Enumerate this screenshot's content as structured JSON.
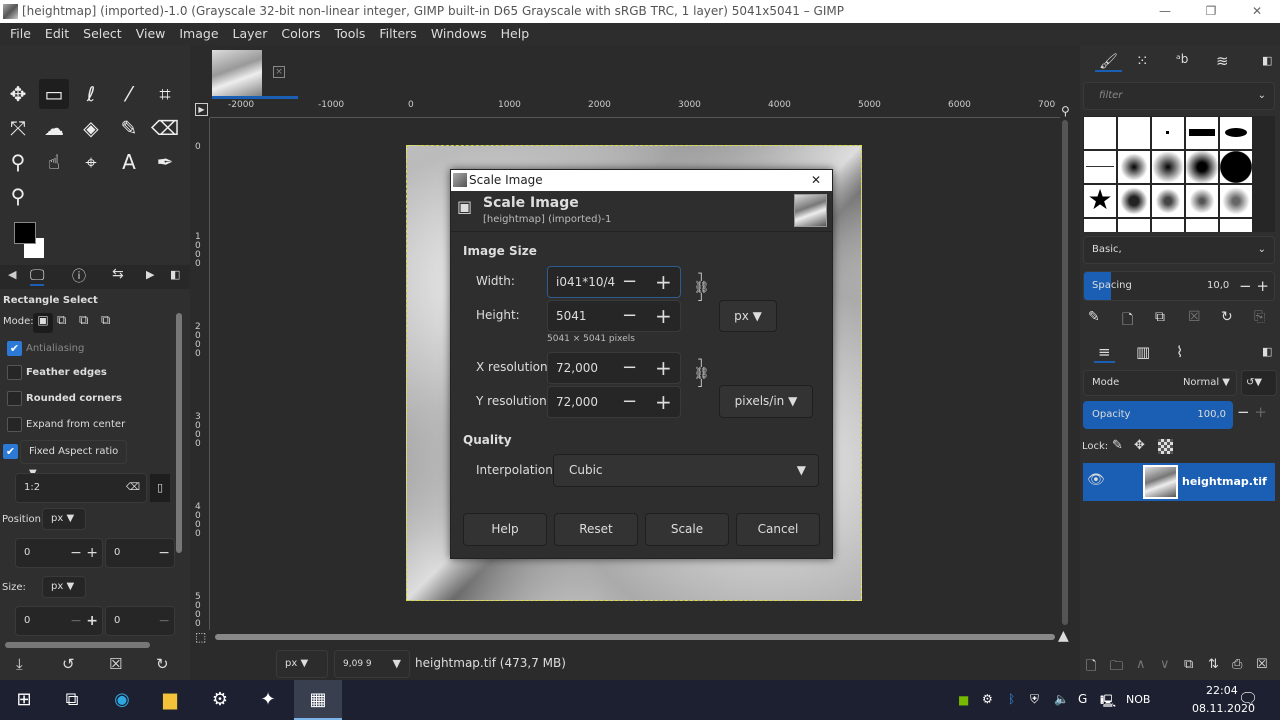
{
  "window": {
    "title": "[heightmap] (imported)-1.0 (Grayscale 32-bit non-linear integer, GIMP built-in D65 Grayscale with sRGB TRC, 1 layer) 5041x5041 – GIMP",
    "minimize": "—",
    "maximize": "❐",
    "close": "✕"
  },
  "menu": [
    "File",
    "Edit",
    "Select",
    "View",
    "Image",
    "Layer",
    "Colors",
    "Tools",
    "Filters",
    "Windows",
    "Help"
  ],
  "tool_options": {
    "title": "Rectangle Select",
    "mode_label": "Mode:",
    "antialiasing": "Antialiasing",
    "feather": "Feather edges",
    "rounded": "Rounded corners",
    "expand": "Expand from center",
    "fixed": "Fixed  Aspect ratio",
    "ratio": "1:2",
    "position_label": "Position:",
    "position_unit": "px",
    "pos_x": "0",
    "pos_y": "0",
    "size_label": "Size:",
    "size_unit": "px",
    "size_x": "0",
    "size_y": "0"
  },
  "rulers": {
    "h": [
      "-2000",
      "-1000",
      "0",
      "1000",
      "2000",
      "3000",
      "4000",
      "5000",
      "6000",
      "700"
    ],
    "v": [
      "0",
      "1000",
      "2000",
      "3000",
      "4000",
      "5000"
    ]
  },
  "dialog": {
    "window_title": "Scale Image",
    "heading": "Scale Image",
    "subtitle": "[heightmap] (imported)-1",
    "image_size": "Image Size",
    "width_label": "Width:",
    "width_value": "i041*10/4",
    "height_label": "Height:",
    "height_value": "5041",
    "size_info": "5041 × 5041 pixels",
    "unit": "px",
    "xres_label": "X resolution:",
    "xres_value": "72,000",
    "yres_label": "Y resolution:",
    "yres_value": "72,000",
    "res_unit": "pixels/in",
    "quality": "Quality",
    "interp_label": "Interpolation:",
    "interp_value": "Cubic",
    "help": "Help",
    "reset": "Reset",
    "scale": "Scale",
    "cancel": "Cancel",
    "close": "✕"
  },
  "brushes": {
    "filter_placeholder": "filter",
    "tag": "Basic,",
    "spacing_label": "Spacing",
    "spacing_value": "10,0",
    "spacing_fraction": 0.1
  },
  "layers": {
    "mode_label": "Mode",
    "mode_value": "Normal",
    "opacity_label": "Opacity",
    "opacity_value": "100,0",
    "lock_label": "Lock:",
    "layer_name": "heightmap.tif"
  },
  "status": {
    "unit": "px",
    "zoom": "9,09 9",
    "file_info": "heightmap.tif (473,7 MB)"
  },
  "taskbar": {
    "lang": "NOB",
    "time": "22:04",
    "date": "08.11.2020"
  },
  "colors": {
    "accent": "#1a5fb4",
    "selection": "#dede40"
  }
}
